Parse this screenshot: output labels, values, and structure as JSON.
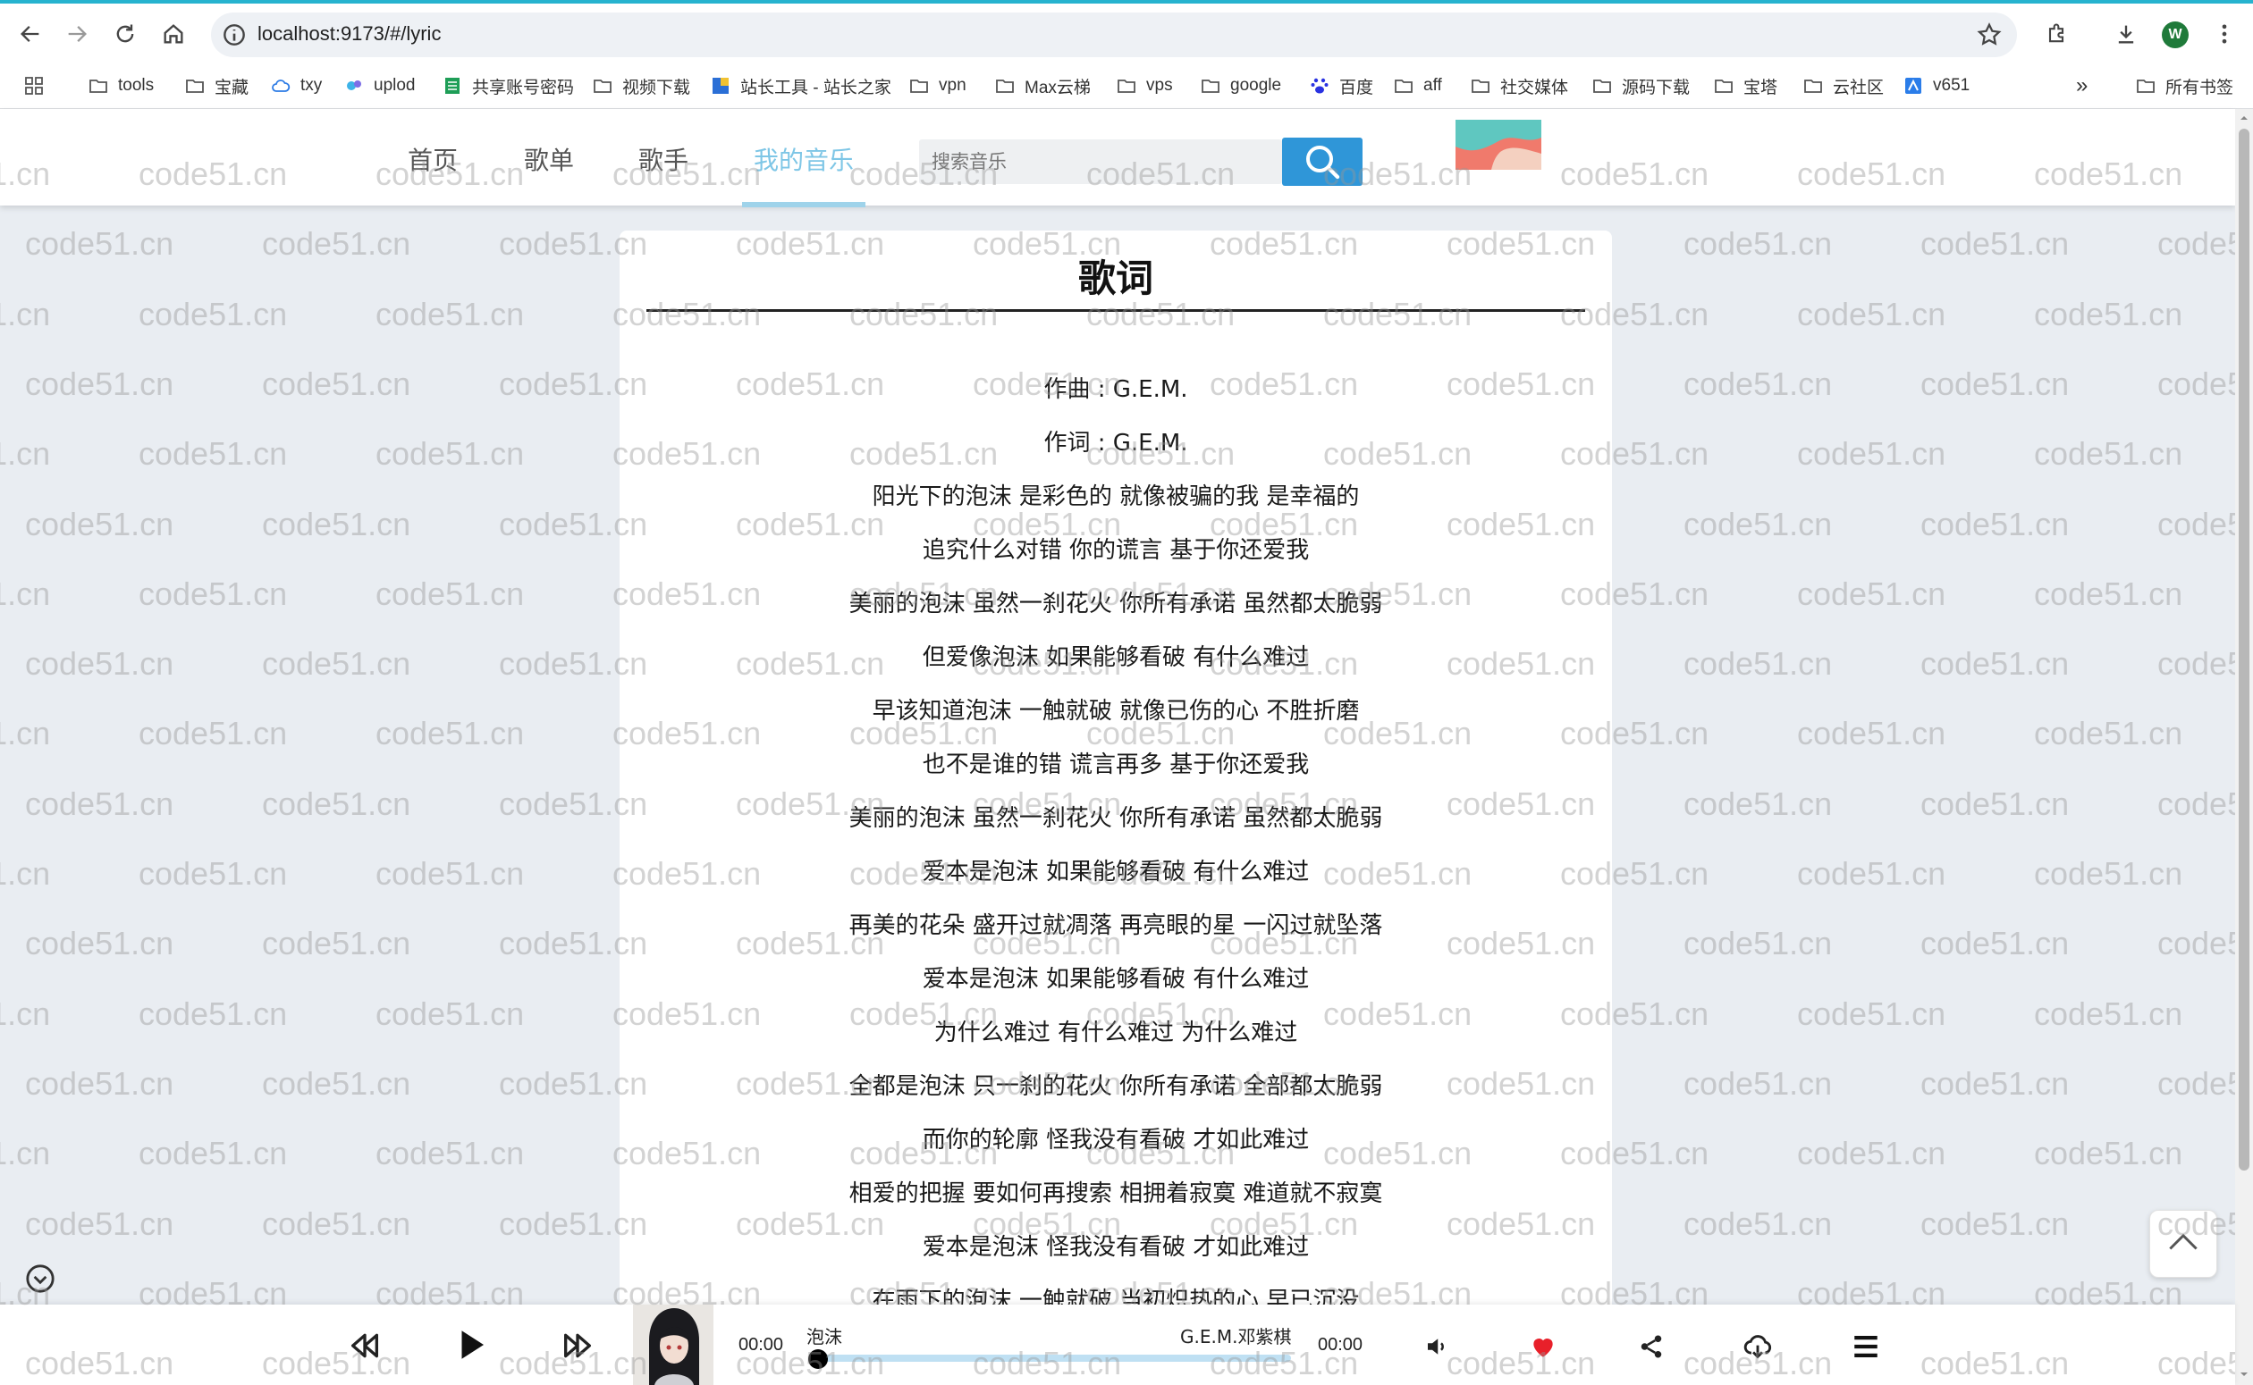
{
  "browser": {
    "url": "localhost:9173/#/lyric",
    "profile_initial": "W",
    "bookmarks": [
      "tools",
      "宝藏",
      "txy",
      "uplod",
      "共享账号密码",
      "视频下载",
      "站长工具 - 站长之家",
      "vpn",
      "Max云梯",
      "vps",
      "google",
      "百度",
      "aff",
      "社交媒体",
      "源码下载",
      "宝塔",
      "云社区",
      "v651"
    ],
    "all_bookmarks": "所有书签",
    "overflow": "»"
  },
  "watermark": "code51.cn",
  "nav": {
    "items": [
      "首页",
      "歌单",
      "歌手",
      "我的音乐"
    ],
    "search_placeholder": "搜索音乐"
  },
  "lyric": {
    "title": "歌词",
    "lines": [
      "作曲 : G.E.M.",
      "作词 : G.E.M.",
      "阳光下的泡沫 是彩色的 就像被骗的我 是幸福的",
      "追究什么对错 你的谎言 基于你还爱我",
      "美丽的泡沫 虽然一刹花火 你所有承诺 虽然都太脆弱",
      "但爱像泡沫 如果能够看破 有什么难过",
      "早该知道泡沫 一触就破 就像已伤的心 不胜折磨",
      "也不是谁的错 谎言再多 基于你还爱我",
      "美丽的泡沫 虽然一刹花火 你所有承诺 虽然都太脆弱",
      "爱本是泡沫 如果能够看破 有什么难过",
      "再美的花朵 盛开过就凋落 再亮眼的星 一闪过就坠落",
      "爱本是泡沫 如果能够看破 有什么难过",
      "为什么难过 有什么难过 为什么难过",
      "全都是泡沫 只一刹的花火 你所有承诺 全部都太脆弱",
      "而你的轮廓 怪我没有看破 才如此难过",
      "相爱的把握 要如何再搜索 相拥着寂寞 难道就不寂寞",
      "爱本是泡沫 怪我没有看破 才如此难过",
      "在雨下的泡沫 一触就破 当初炽热的心 早已沉没"
    ]
  },
  "player": {
    "current_time": "00:00",
    "total_time": "00:00",
    "song": "泡沫",
    "artist": "G.E.M.邓紫棋",
    "progress": 0,
    "liked": true,
    "like_color": "#e8202a"
  }
}
